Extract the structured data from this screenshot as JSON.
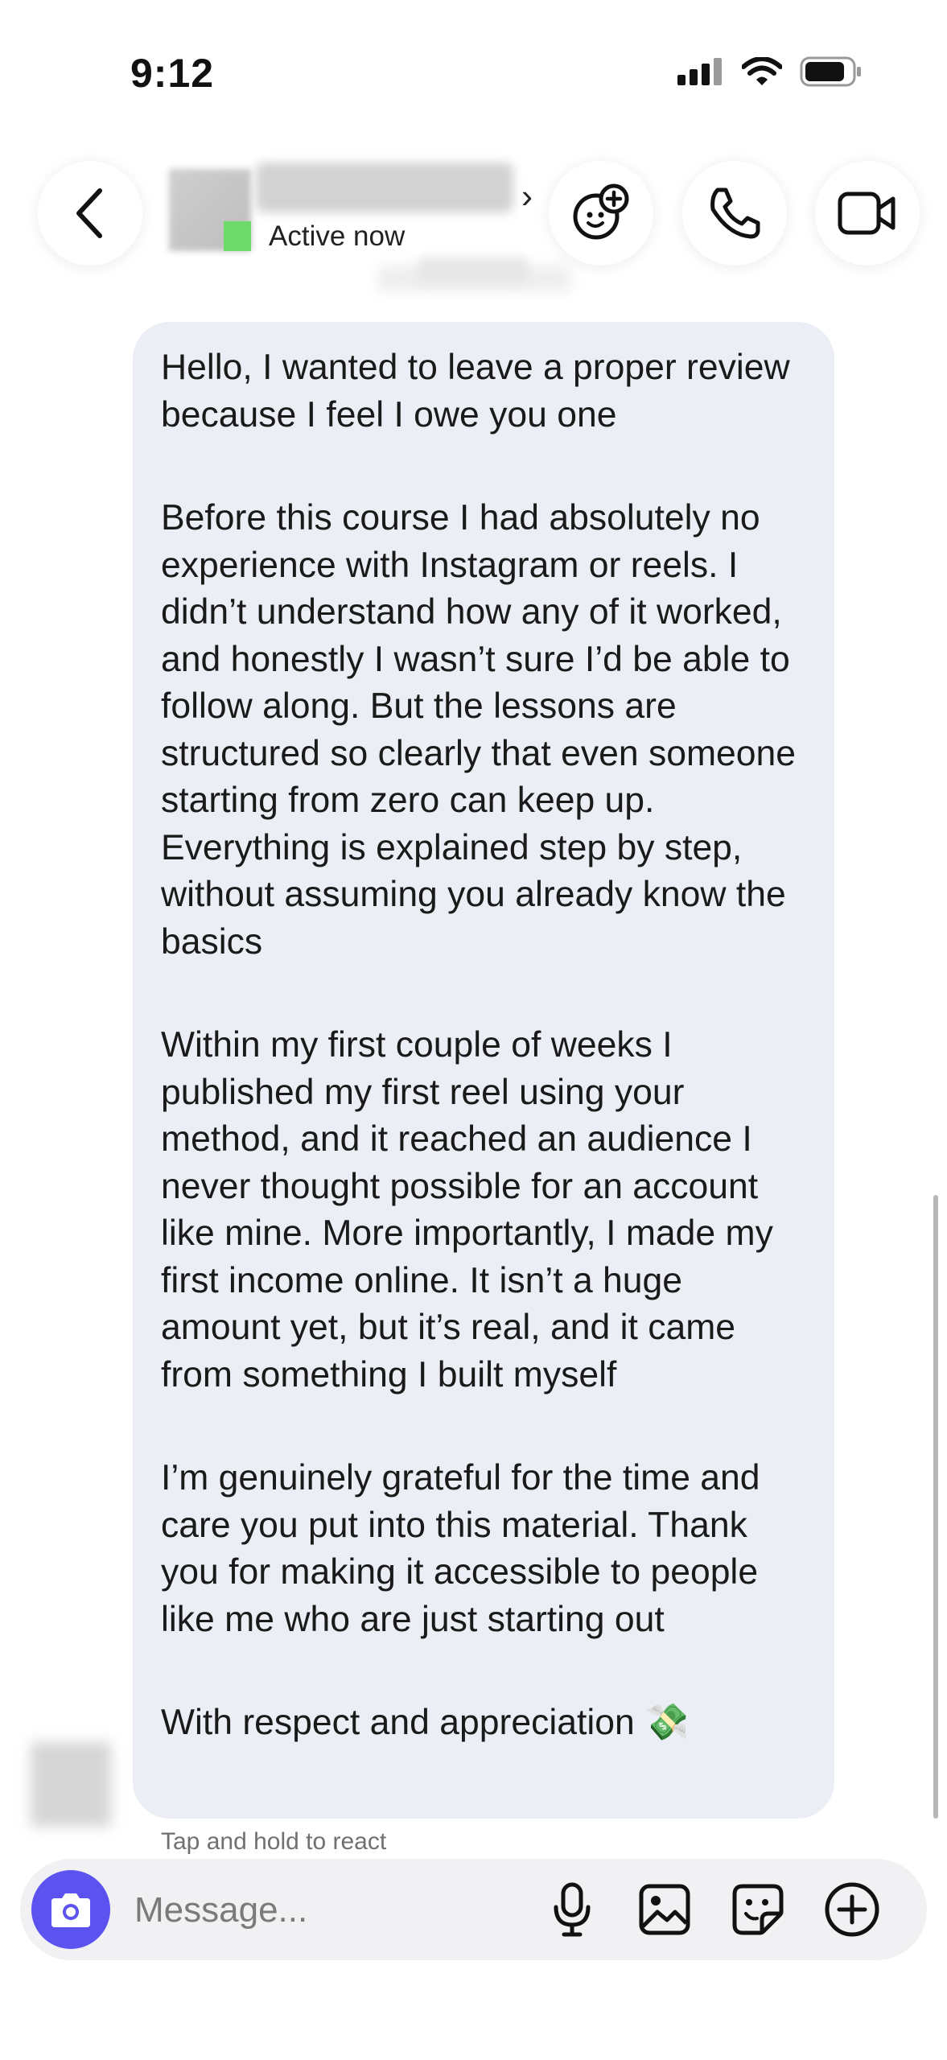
{
  "status_bar": {
    "time": "9:12",
    "icons": [
      "cellular-signal-icon",
      "wifi-icon",
      "battery-icon"
    ]
  },
  "header": {
    "back_icon": "chevron-left-icon",
    "contact_status": "Active now",
    "name_chevron": "›",
    "actions": [
      {
        "icon": "effects-plus-icon"
      },
      {
        "icon": "phone-icon"
      },
      {
        "icon": "video-camera-icon"
      }
    ]
  },
  "message": {
    "paragraphs": [
      "Hello, I wanted to leave a proper review because I feel I owe you one",
      "Before this course I had absolutely no experience with Instagram or reels. I didn’t understand how any of it worked, and honestly I wasn’t sure I’d be able to follow along. But the lessons are structured so clearly that even someone starting from zero can keep up. Everything is explained step by step, without assuming you already know the basics",
      "Within my first couple of weeks I published my first reel using your method, and it reached an audience I never thought possible for an account like mine. More importantly, I made my first income online. It isn’t a huge amount yet, but it’s real, and it came from something I built myself",
      "I’m genuinely grateful for the time and care you put into this material. Thank you for making it accessible to people like me who are just starting out",
      "With respect and appreciation 💸"
    ],
    "hint": "Tap and hold to react"
  },
  "composer": {
    "placeholder": "Message...",
    "icons": [
      "camera-icon",
      "microphone-icon",
      "image-icon",
      "sticker-icon",
      "plus-icon"
    ]
  },
  "colors": {
    "bubble": "#ebeef5",
    "camera_button": "#5c52f0",
    "online_dot": "#6ddb69"
  }
}
